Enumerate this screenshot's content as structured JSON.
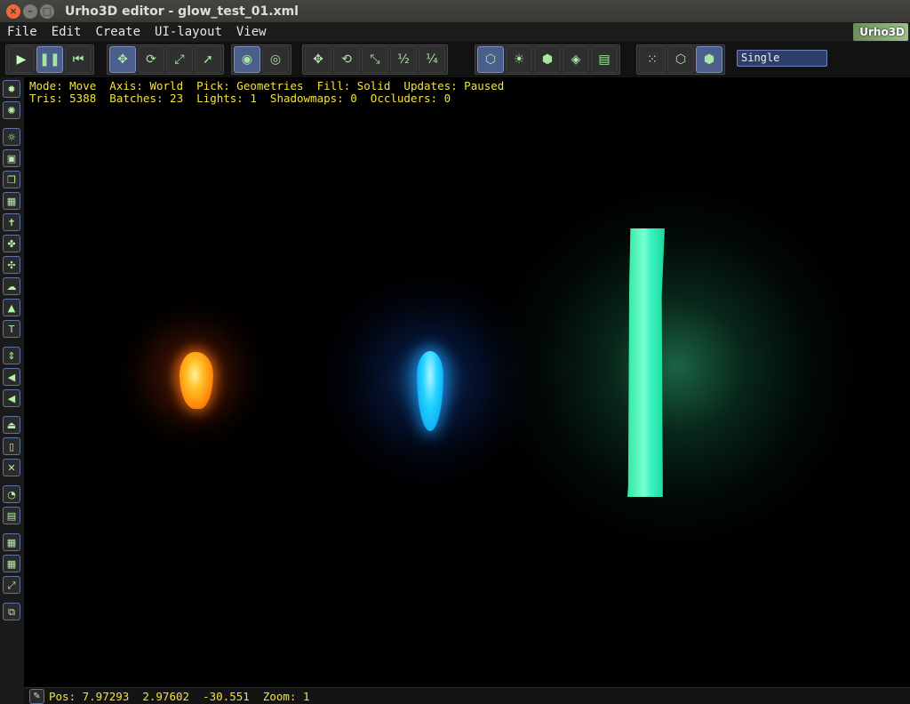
{
  "window": {
    "title": "Urho3D editor - glow_test_01.xml",
    "close_glyph": "×",
    "min_glyph": "–",
    "max_glyph": "□"
  },
  "menu": {
    "items": [
      "File",
      "Edit",
      "Create",
      "UI-layout",
      "View"
    ],
    "logo_text": "Urho3D"
  },
  "toolbar": {
    "icons": {
      "play": "▶",
      "pause": "❚❚",
      "rewind": "⏮",
      "move": "✥",
      "rotate": "⟳",
      "scale": "⤢",
      "select": "➚",
      "pick_world": "◉",
      "pick_local": "◎",
      "snap_move": "✥",
      "snap_rotate": "⟲",
      "snap_scale": "⤡",
      "half": "½",
      "quarter": "¼",
      "pick_geometries": "⬡",
      "pick_lights": "☀",
      "pick_zones": "⬢",
      "pick_rigidbodies": "◈",
      "pick_ui": "▤",
      "fill_point": "⁙",
      "fill_wireframe": "⬡",
      "fill_solid": "⬢"
    },
    "view_mode": "Single"
  },
  "left_toolbar": {
    "icons": [
      "✹",
      "✺",
      "☼",
      "▣",
      "❐",
      "▦",
      "✝",
      "✤",
      "✣",
      "☁",
      "▲",
      "T",
      "⇕",
      "◀",
      "◀",
      "⏏",
      "▯",
      "✕",
      "◔",
      "▤",
      "▦",
      "▦",
      "⤢",
      "⧉"
    ]
  },
  "viewport": {
    "stats_line1": "Mode: Move  Axis: World  Pick: Geometries  Fill: Solid  Updates: Paused",
    "stats_line2": "Tris: 5388  Batches: 23  Lights: 1  Shadowmaps: 0  Occluders: 0"
  },
  "status": {
    "icon": "✎",
    "text": "Pos: 7.97293  2.97602  -30.551  Zoom: 1"
  }
}
